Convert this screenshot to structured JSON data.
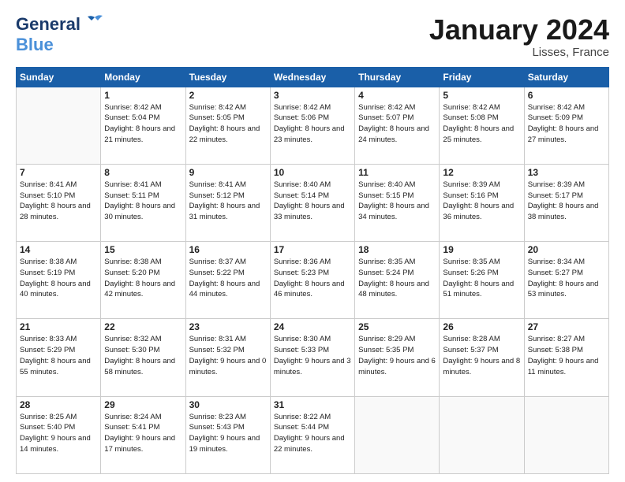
{
  "header": {
    "logo": {
      "line1": "General",
      "line2": "Blue"
    },
    "title": "January 2024",
    "location": "Lisses, France"
  },
  "weekdays": [
    "Sunday",
    "Monday",
    "Tuesday",
    "Wednesday",
    "Thursday",
    "Friday",
    "Saturday"
  ],
  "weeks": [
    [
      {
        "day": "",
        "sunrise": "",
        "sunset": "",
        "daylight": ""
      },
      {
        "day": "1",
        "sunrise": "Sunrise: 8:42 AM",
        "sunset": "Sunset: 5:04 PM",
        "daylight": "Daylight: 8 hours and 21 minutes."
      },
      {
        "day": "2",
        "sunrise": "Sunrise: 8:42 AM",
        "sunset": "Sunset: 5:05 PM",
        "daylight": "Daylight: 8 hours and 22 minutes."
      },
      {
        "day": "3",
        "sunrise": "Sunrise: 8:42 AM",
        "sunset": "Sunset: 5:06 PM",
        "daylight": "Daylight: 8 hours and 23 minutes."
      },
      {
        "day": "4",
        "sunrise": "Sunrise: 8:42 AM",
        "sunset": "Sunset: 5:07 PM",
        "daylight": "Daylight: 8 hours and 24 minutes."
      },
      {
        "day": "5",
        "sunrise": "Sunrise: 8:42 AM",
        "sunset": "Sunset: 5:08 PM",
        "daylight": "Daylight: 8 hours and 25 minutes."
      },
      {
        "day": "6",
        "sunrise": "Sunrise: 8:42 AM",
        "sunset": "Sunset: 5:09 PM",
        "daylight": "Daylight: 8 hours and 27 minutes."
      }
    ],
    [
      {
        "day": "7",
        "sunrise": "Sunrise: 8:41 AM",
        "sunset": "Sunset: 5:10 PM",
        "daylight": "Daylight: 8 hours and 28 minutes."
      },
      {
        "day": "8",
        "sunrise": "Sunrise: 8:41 AM",
        "sunset": "Sunset: 5:11 PM",
        "daylight": "Daylight: 8 hours and 30 minutes."
      },
      {
        "day": "9",
        "sunrise": "Sunrise: 8:41 AM",
        "sunset": "Sunset: 5:12 PM",
        "daylight": "Daylight: 8 hours and 31 minutes."
      },
      {
        "day": "10",
        "sunrise": "Sunrise: 8:40 AM",
        "sunset": "Sunset: 5:14 PM",
        "daylight": "Daylight: 8 hours and 33 minutes."
      },
      {
        "day": "11",
        "sunrise": "Sunrise: 8:40 AM",
        "sunset": "Sunset: 5:15 PM",
        "daylight": "Daylight: 8 hours and 34 minutes."
      },
      {
        "day": "12",
        "sunrise": "Sunrise: 8:39 AM",
        "sunset": "Sunset: 5:16 PM",
        "daylight": "Daylight: 8 hours and 36 minutes."
      },
      {
        "day": "13",
        "sunrise": "Sunrise: 8:39 AM",
        "sunset": "Sunset: 5:17 PM",
        "daylight": "Daylight: 8 hours and 38 minutes."
      }
    ],
    [
      {
        "day": "14",
        "sunrise": "Sunrise: 8:38 AM",
        "sunset": "Sunset: 5:19 PM",
        "daylight": "Daylight: 8 hours and 40 minutes."
      },
      {
        "day": "15",
        "sunrise": "Sunrise: 8:38 AM",
        "sunset": "Sunset: 5:20 PM",
        "daylight": "Daylight: 8 hours and 42 minutes."
      },
      {
        "day": "16",
        "sunrise": "Sunrise: 8:37 AM",
        "sunset": "Sunset: 5:22 PM",
        "daylight": "Daylight: 8 hours and 44 minutes."
      },
      {
        "day": "17",
        "sunrise": "Sunrise: 8:36 AM",
        "sunset": "Sunset: 5:23 PM",
        "daylight": "Daylight: 8 hours and 46 minutes."
      },
      {
        "day": "18",
        "sunrise": "Sunrise: 8:35 AM",
        "sunset": "Sunset: 5:24 PM",
        "daylight": "Daylight: 8 hours and 48 minutes."
      },
      {
        "day": "19",
        "sunrise": "Sunrise: 8:35 AM",
        "sunset": "Sunset: 5:26 PM",
        "daylight": "Daylight: 8 hours and 51 minutes."
      },
      {
        "day": "20",
        "sunrise": "Sunrise: 8:34 AM",
        "sunset": "Sunset: 5:27 PM",
        "daylight": "Daylight: 8 hours and 53 minutes."
      }
    ],
    [
      {
        "day": "21",
        "sunrise": "Sunrise: 8:33 AM",
        "sunset": "Sunset: 5:29 PM",
        "daylight": "Daylight: 8 hours and 55 minutes."
      },
      {
        "day": "22",
        "sunrise": "Sunrise: 8:32 AM",
        "sunset": "Sunset: 5:30 PM",
        "daylight": "Daylight: 8 hours and 58 minutes."
      },
      {
        "day": "23",
        "sunrise": "Sunrise: 8:31 AM",
        "sunset": "Sunset: 5:32 PM",
        "daylight": "Daylight: 9 hours and 0 minutes."
      },
      {
        "day": "24",
        "sunrise": "Sunrise: 8:30 AM",
        "sunset": "Sunset: 5:33 PM",
        "daylight": "Daylight: 9 hours and 3 minutes."
      },
      {
        "day": "25",
        "sunrise": "Sunrise: 8:29 AM",
        "sunset": "Sunset: 5:35 PM",
        "daylight": "Daylight: 9 hours and 6 minutes."
      },
      {
        "day": "26",
        "sunrise": "Sunrise: 8:28 AM",
        "sunset": "Sunset: 5:37 PM",
        "daylight": "Daylight: 9 hours and 8 minutes."
      },
      {
        "day": "27",
        "sunrise": "Sunrise: 8:27 AM",
        "sunset": "Sunset: 5:38 PM",
        "daylight": "Daylight: 9 hours and 11 minutes."
      }
    ],
    [
      {
        "day": "28",
        "sunrise": "Sunrise: 8:25 AM",
        "sunset": "Sunset: 5:40 PM",
        "daylight": "Daylight: 9 hours and 14 minutes."
      },
      {
        "day": "29",
        "sunrise": "Sunrise: 8:24 AM",
        "sunset": "Sunset: 5:41 PM",
        "daylight": "Daylight: 9 hours and 17 minutes."
      },
      {
        "day": "30",
        "sunrise": "Sunrise: 8:23 AM",
        "sunset": "Sunset: 5:43 PM",
        "daylight": "Daylight: 9 hours and 19 minutes."
      },
      {
        "day": "31",
        "sunrise": "Sunrise: 8:22 AM",
        "sunset": "Sunset: 5:44 PM",
        "daylight": "Daylight: 9 hours and 22 minutes."
      },
      {
        "day": "",
        "sunrise": "",
        "sunset": "",
        "daylight": ""
      },
      {
        "day": "",
        "sunrise": "",
        "sunset": "",
        "daylight": ""
      },
      {
        "day": "",
        "sunrise": "",
        "sunset": "",
        "daylight": ""
      }
    ]
  ]
}
